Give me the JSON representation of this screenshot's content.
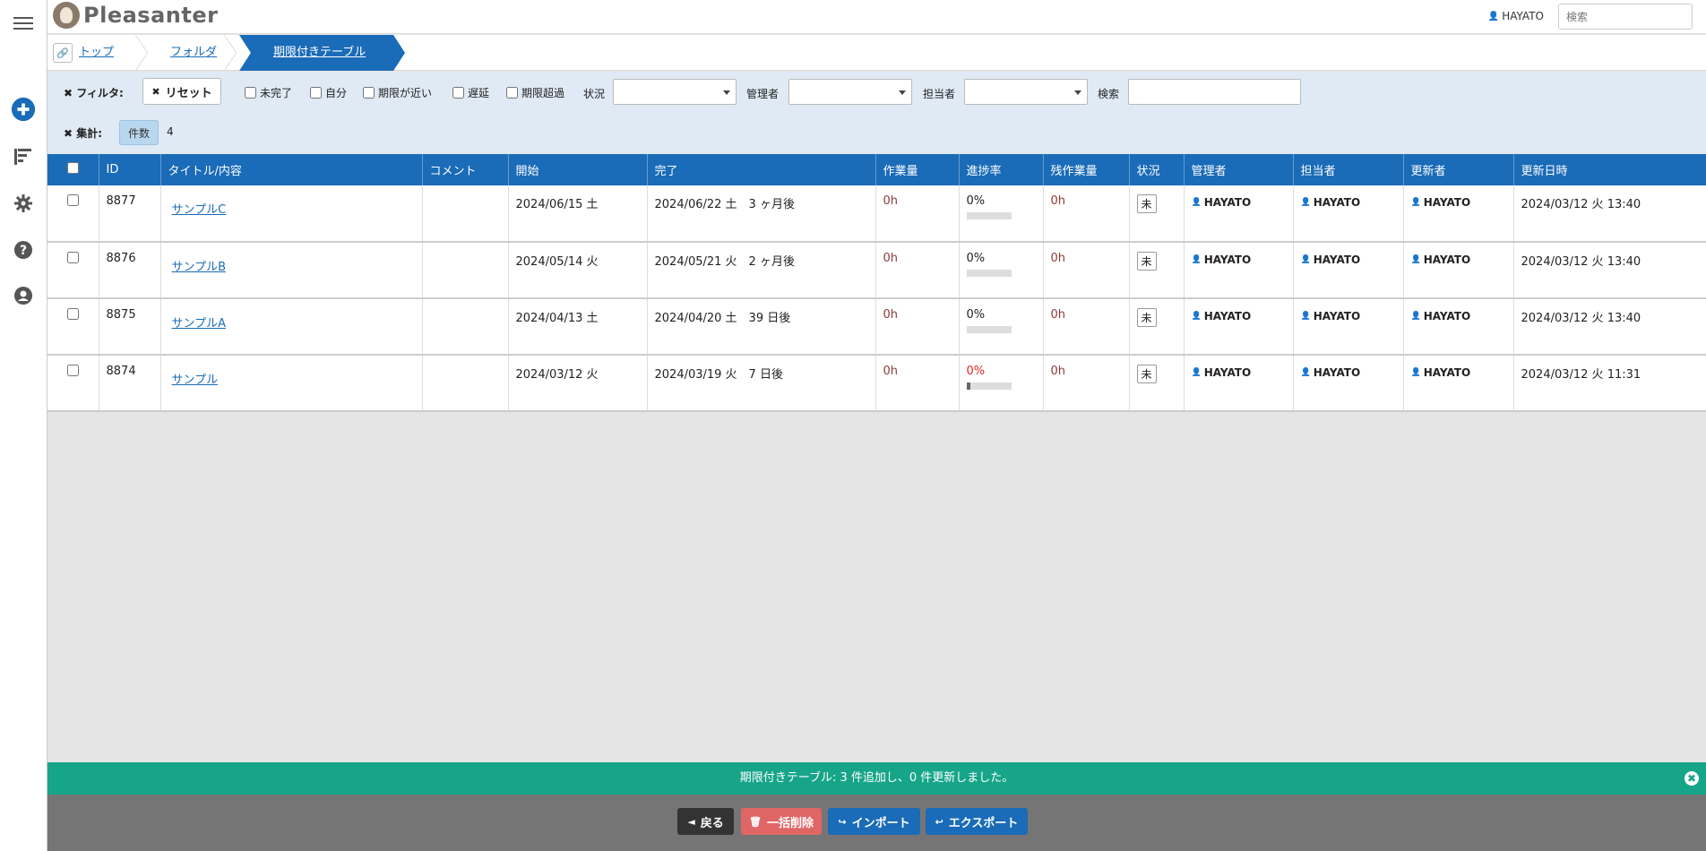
{
  "app": {
    "name": "Pleasanter"
  },
  "header": {
    "user": "HAYATO",
    "search_placeholder": "検索"
  },
  "breadcrumb": {
    "items": [
      "トップ",
      "フォルダ",
      "期限付きテーブル"
    ]
  },
  "filters": {
    "filter_label": "フィルタ:",
    "reset_label": "リセット",
    "checkboxes": [
      "未完了",
      "自分",
      "期限が近い",
      "遅延",
      "期限超過"
    ],
    "status_label": "状況",
    "manager_label": "管理者",
    "owner_label": "担当者",
    "search_label": "検索",
    "aggregate_label": "集計:",
    "count_label": "件数",
    "count_value": "4"
  },
  "table": {
    "columns": [
      "ID",
      "タイトル/内容",
      "コメント",
      "開始",
      "完了",
      "作業量",
      "進捗率",
      "残作業量",
      "状況",
      "管理者",
      "担当者",
      "更新者",
      "更新日時"
    ],
    "rows": [
      {
        "id": "8877",
        "title": "サンプルC",
        "comment": "",
        "start": "2024/06/15 土",
        "end": "2024/06/22 土　3 ヶ月後",
        "work": "0h",
        "progress": "0%",
        "progress_value": 0,
        "remain": "0h",
        "status": "未",
        "manager": "HAYATO",
        "owner": "HAYATO",
        "updater": "HAYATO",
        "updated": "2024/03/12 火 13:40"
      },
      {
        "id": "8876",
        "title": "サンプルB",
        "comment": "",
        "start": "2024/05/14 火",
        "end": "2024/05/21 火　2 ヶ月後",
        "work": "0h",
        "progress": "0%",
        "progress_value": 0,
        "remain": "0h",
        "status": "未",
        "manager": "HAYATO",
        "owner": "HAYATO",
        "updater": "HAYATO",
        "updated": "2024/03/12 火 13:40"
      },
      {
        "id": "8875",
        "title": "サンプルA",
        "comment": "",
        "start": "2024/04/13 土",
        "end": "2024/04/20 土　39 日後",
        "work": "0h",
        "progress": "0%",
        "progress_value": 0,
        "remain": "0h",
        "status": "未",
        "manager": "HAYATO",
        "owner": "HAYATO",
        "updater": "HAYATO",
        "updated": "2024/03/12 火 13:40"
      },
      {
        "id": "8874",
        "title": "サンプル",
        "comment": "",
        "start": "2024/03/12 火",
        "end": "2024/03/19 火　7 日後",
        "work": "0h",
        "progress": "0%",
        "progress_value": 0,
        "remain": "0h",
        "status": "未",
        "manager": "HAYATO",
        "owner": "HAYATO",
        "updater": "HAYATO",
        "updated": "2024/03/12 火 11:31"
      }
    ]
  },
  "message": {
    "text": "期限付きテーブル: 3 件追加し、0 件更新しました。"
  },
  "footer": {
    "back_label": "戻る",
    "bulk_delete_label": "一括削除",
    "import_label": "インポート",
    "export_label": "エクスポート"
  },
  "colors": {
    "primary": "#1a6bb8",
    "success": "#17a589",
    "danger": "#e06666",
    "dark": "#333333"
  }
}
